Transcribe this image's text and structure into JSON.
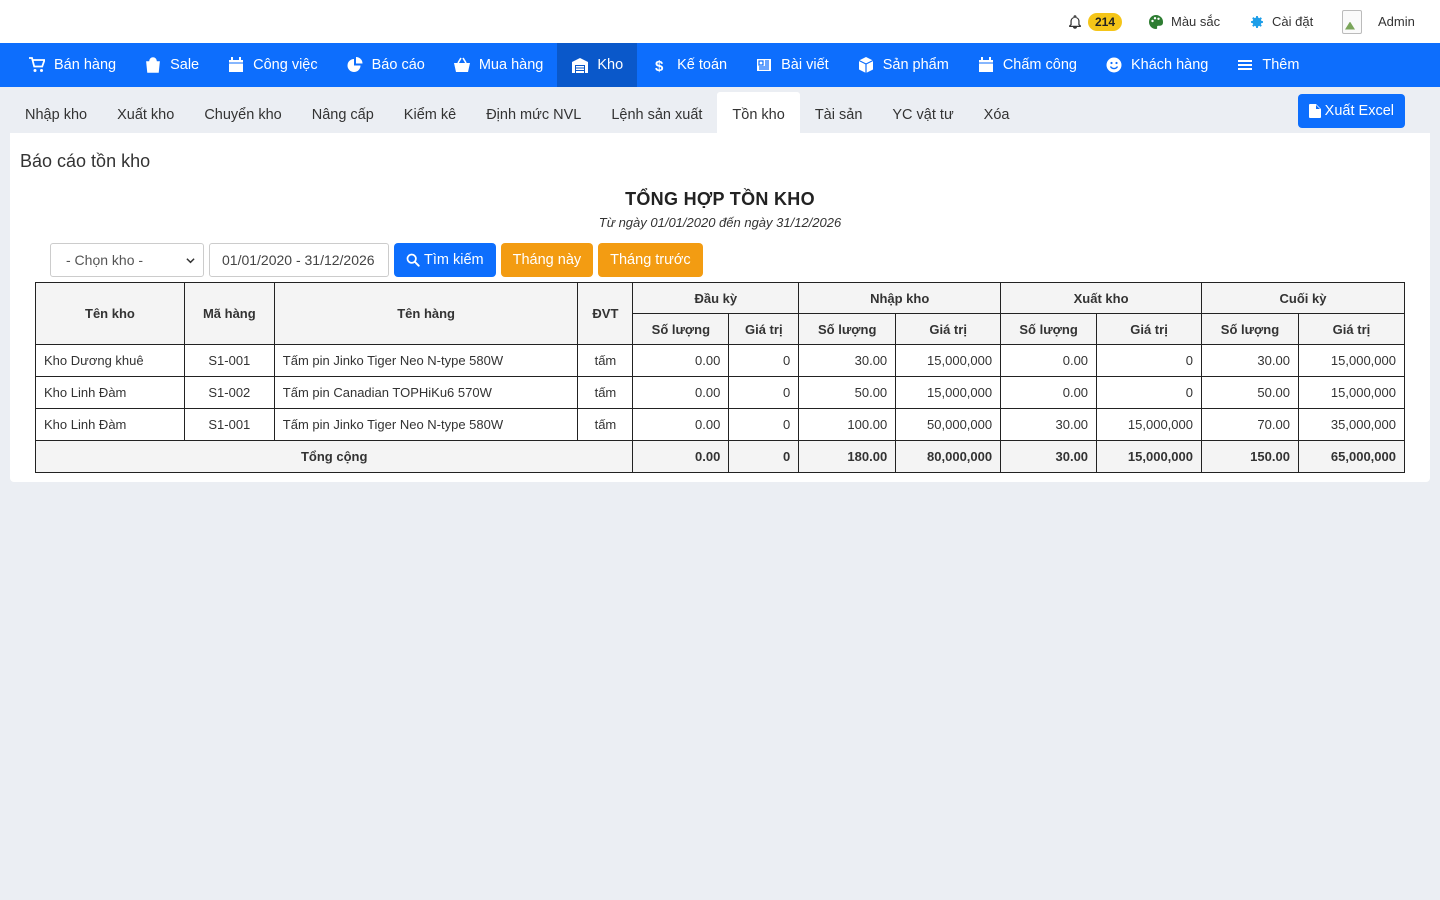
{
  "topbar": {
    "notification_count": "214",
    "color_label": "Màu sắc",
    "settings_label": "Cài đặt",
    "user_label": "Admin"
  },
  "nav": [
    {
      "label": "Bán hàng",
      "icon": "cart-icon"
    },
    {
      "label": "Sale",
      "icon": "bag-icon"
    },
    {
      "label": "Công việc",
      "icon": "calendar-icon"
    },
    {
      "label": "Báo cáo",
      "icon": "pie-chart-icon"
    },
    {
      "label": "Mua hàng",
      "icon": "basket-icon"
    },
    {
      "label": "Kho",
      "icon": "warehouse-icon",
      "active": true
    },
    {
      "label": "Kế toán",
      "icon": "dollar-icon"
    },
    {
      "label": "Bài viết",
      "icon": "newspaper-icon"
    },
    {
      "label": "Sản phẩm",
      "icon": "box-icon"
    },
    {
      "label": "Chấm công",
      "icon": "calendar-icon"
    },
    {
      "label": "Khách hàng",
      "icon": "smile-icon"
    },
    {
      "label": "Thêm",
      "icon": "menu-icon"
    }
  ],
  "tabs": [
    "Nhập kho",
    "Xuất kho",
    "Chuyển kho",
    "Nâng cấp",
    "Kiểm kê",
    "Định mức NVL",
    "Lệnh sản xuất",
    "Tồn kho",
    "Tài sản",
    "YC vật tư",
    "Xóa"
  ],
  "active_tab": "Tồn kho",
  "export_label": "Xuất Excel",
  "panel_title": "Báo cáo tồn kho",
  "report": {
    "title": "TỔNG HỢP TỒN KHO",
    "subtitle": "Từ ngày 01/01/2020 đến ngày 31/12/2026"
  },
  "filters": {
    "warehouse_placeholder": "- Chọn kho -",
    "date_range": "01/01/2020 - 31/12/2026",
    "search_label": "Tìm kiếm",
    "this_month_label": "Tháng này",
    "last_month_label": "Tháng trước"
  },
  "table": {
    "headers": {
      "warehouse": "Tên kho",
      "code": "Mã hàng",
      "name": "Tên hàng",
      "unit": "ĐVT",
      "opening": "Đầu kỳ",
      "inbound": "Nhập kho",
      "outbound": "Xuất kho",
      "closing": "Cuối kỳ",
      "qty": "Số lượng",
      "value": "Giá trị"
    },
    "rows": [
      [
        "Kho Dương khuê",
        "S1-001",
        "Tấm pin Jinko Tiger Neo N-type 580W",
        "tấm",
        "0.00",
        "0",
        "30.00",
        "15,000,000",
        "0.00",
        "0",
        "30.00",
        "15,000,000"
      ],
      [
        "Kho Linh Đàm",
        "S1-002",
        "Tấm pin Canadian TOPHiKu6 570W",
        "tấm",
        "0.00",
        "0",
        "50.00",
        "15,000,000",
        "0.00",
        "0",
        "50.00",
        "15,000,000"
      ],
      [
        "Kho Linh Đàm",
        "S1-001",
        "Tấm pin Jinko Tiger Neo N-type 580W",
        "tấm",
        "0.00",
        "0",
        "100.00",
        "50,000,000",
        "30.00",
        "15,000,000",
        "70.00",
        "35,000,000"
      ]
    ],
    "total": {
      "label": "Tổng cộng",
      "values": [
        "0.00",
        "0",
        "180.00",
        "80,000,000",
        "30.00",
        "15,000,000",
        "150.00",
        "65,000,000"
      ]
    }
  },
  "colors": {
    "primary": "#0d6efd",
    "primary_active": "#0a58ca",
    "warning": "#f39c12",
    "badge": "#f5c518",
    "link": "#3c8dbc"
  }
}
